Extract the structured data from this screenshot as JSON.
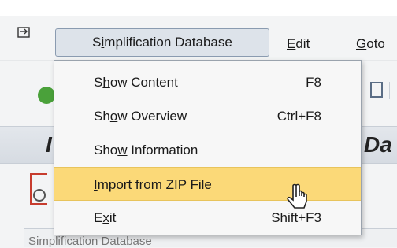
{
  "menubar": {
    "active_menu": {
      "before": "S",
      "underline": "i",
      "after": "mplification Database"
    },
    "edit": {
      "underline": "E",
      "after": "dit"
    },
    "goto": {
      "underline": "G",
      "after": "oto"
    }
  },
  "background": {
    "title_fragment_left": "I",
    "title_fragment_right": "Da",
    "bottom_text": "Simplification Database"
  },
  "dropdown": {
    "items": [
      {
        "label_before": "S",
        "underline": "h",
        "label_after": "ow Content",
        "shortcut": "F8"
      },
      {
        "label_before": "Sh",
        "underline": "o",
        "label_after": "w Overview",
        "shortcut": "Ctrl+F8"
      },
      {
        "label_before": "Sho",
        "underline": "w",
        "label_after": " Information",
        "shortcut": ""
      },
      {
        "label_before": "",
        "underline": "I",
        "label_after": "mport from ZIP File",
        "shortcut": ""
      },
      {
        "label_before": "E",
        "underline": "x",
        "label_after": "it",
        "shortcut": "Shift+F3"
      }
    ],
    "highlighted_index": 3
  },
  "colors": {
    "highlight": "#fbd978",
    "menu_active_bg": "#dde3ea"
  }
}
